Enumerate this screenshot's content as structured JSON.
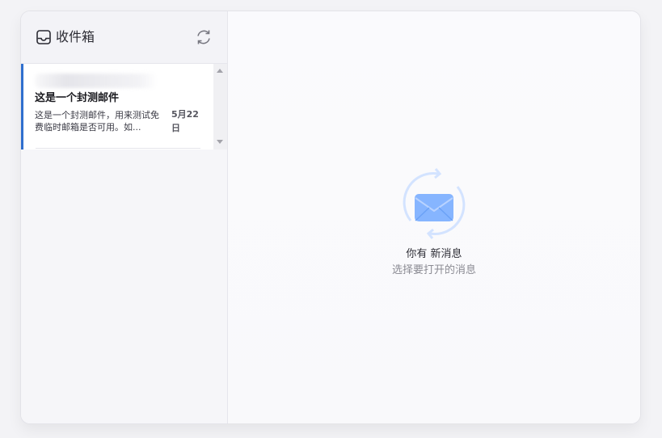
{
  "sidebar": {
    "title": "收件箱",
    "icons": {
      "inbox": "inbox-icon",
      "refresh": "refresh-icon"
    }
  },
  "messages": [
    {
      "subject": "这是一个封测邮件",
      "preview": "这是一个封测邮件，用来测试免费临时邮箱是否可用。如...",
      "date": "5月22日",
      "selected": true
    }
  ],
  "main": {
    "empty_title": "你有 新消息",
    "empty_subtitle": "选择要打开的消息",
    "icon": "mail-refresh-icon"
  },
  "colors": {
    "accent": "#2f6fce",
    "envelope": "#8bb6ff",
    "cycle": "#cfe0ff"
  }
}
